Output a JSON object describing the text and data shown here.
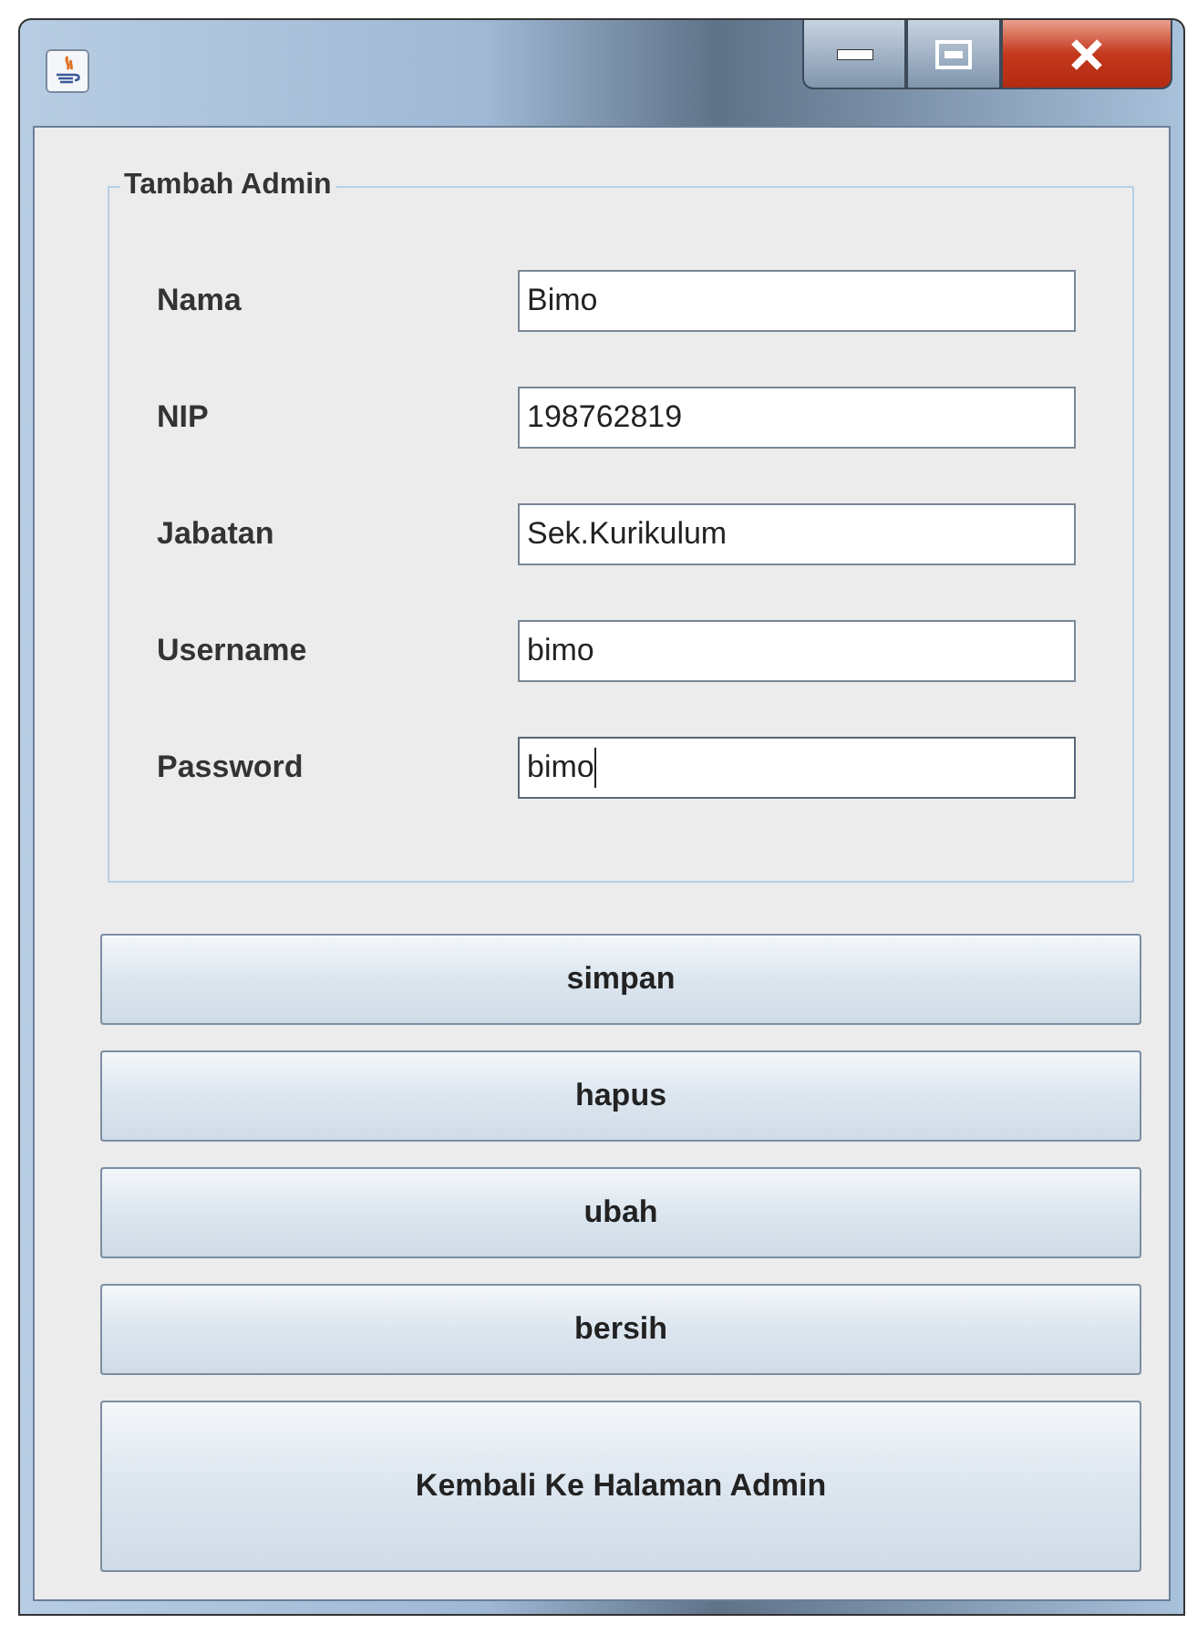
{
  "group": {
    "title": "Tambah Admin",
    "fields": [
      {
        "label": "Nama",
        "value": "Bimo",
        "focused": false
      },
      {
        "label": "NIP",
        "value": "198762819",
        "focused": false
      },
      {
        "label": "Jabatan",
        "value": "Sek.Kurikulum",
        "focused": false
      },
      {
        "label": "Username",
        "value": "bimo",
        "focused": false
      },
      {
        "label": "Password",
        "value": "bimo",
        "focused": true
      }
    ]
  },
  "buttons": [
    {
      "label": "simpan",
      "kind": "small"
    },
    {
      "label": "hapus",
      "kind": "small"
    },
    {
      "label": "ubah",
      "kind": "small"
    },
    {
      "label": "bersih",
      "kind": "small"
    },
    {
      "label": "Kembali Ke Halaman Admin",
      "kind": "large"
    }
  ]
}
